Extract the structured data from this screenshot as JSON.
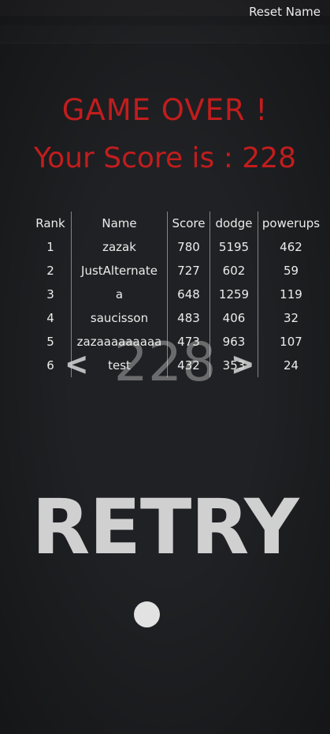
{
  "header": {
    "reset_label": "Reset Name"
  },
  "game_over": {
    "title": "GAME OVER !",
    "score_line": "Your Score is : 228",
    "score_value": "228"
  },
  "leaderboard": {
    "columns": [
      "Rank",
      "Name",
      "Score",
      "dodge",
      "powerups"
    ],
    "rows": [
      [
        "1",
        "zazak",
        "780",
        "5195",
        "462"
      ],
      [
        "2",
        "JustAlternate",
        "727",
        "602",
        "59"
      ],
      [
        "3",
        "a",
        "648",
        "1259",
        "119"
      ],
      [
        "4",
        "saucisson",
        "483",
        "406",
        "32"
      ],
      [
        "5",
        "zazaaaaaaaaa",
        "473",
        "963",
        "107"
      ],
      [
        "6",
        "test",
        "432",
        "353",
        "24"
      ]
    ]
  },
  "navigation": {
    "prev_label": "<",
    "next_label": ">"
  },
  "retry": {
    "label": "RETRY"
  },
  "colors": {
    "title_red": "#c21d1d",
    "background": "#202124",
    "text": "#ececec"
  }
}
